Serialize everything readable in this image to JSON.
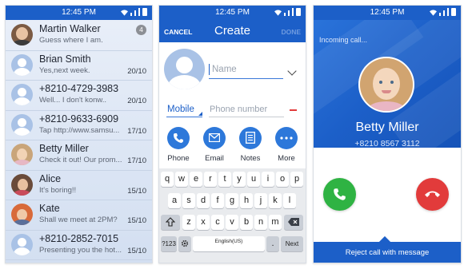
{
  "status_bar": {
    "time": "12:45 PM"
  },
  "messages": [
    {
      "name": "Martin Walker",
      "preview": "Guess where I am.",
      "date": "",
      "badge": "4"
    },
    {
      "name": "Brian Smith",
      "preview": "Yes,next week.",
      "date": "20/10",
      "badge": ""
    },
    {
      "name": "+8210-4729-3983",
      "preview": "Well... I don't konw..",
      "date": "20/10",
      "badge": ""
    },
    {
      "name": "+8210-9633-6909",
      "preview": "Tap http://www.samsu...",
      "date": "17/10",
      "badge": ""
    },
    {
      "name": "Betty Miller",
      "preview": "Check it out! Our prom...",
      "date": "17/10",
      "badge": ""
    },
    {
      "name": "Alice",
      "preview": "It's boring!!",
      "date": "15/10",
      "badge": ""
    },
    {
      "name": "Kate",
      "preview": "Shall we meet at 2PM?",
      "date": "15/10",
      "badge": ""
    },
    {
      "name": "+8210-2852-7015",
      "preview": "Presenting you the hot...",
      "date": "15/10",
      "badge": ""
    }
  ],
  "create": {
    "cancel": "CANCEL",
    "title": "Create",
    "done": "DONE",
    "name_placeholder": "Name",
    "phone_type": "Mobile",
    "phone_placeholder": "Phone number",
    "actions": [
      {
        "label": "Phone",
        "icon": "phone-icon"
      },
      {
        "label": "Email",
        "icon": "email-icon"
      },
      {
        "label": "Notes",
        "icon": "notes-icon"
      },
      {
        "label": "More",
        "icon": "more-icon"
      }
    ]
  },
  "keyboard": {
    "row1": [
      "q",
      "w",
      "e",
      "r",
      "t",
      "y",
      "u",
      "i",
      "o",
      "p"
    ],
    "row2": [
      "a",
      "s",
      "d",
      "f",
      "g",
      "h",
      "j",
      "k",
      "l"
    ],
    "row3": [
      "z",
      "x",
      "c",
      "v",
      "b",
      "n",
      "m"
    ],
    "sym_key": "?123",
    "language_key": "English(US)",
    "period_key": ".",
    "next_key": "Next"
  },
  "call": {
    "label": "Incoming call...",
    "name": "Betty Miller",
    "number": "+8210 8567 3112",
    "reject_message": "Reject call with message"
  },
  "colors": {
    "primary": "#1c5fc8",
    "answer": "#2fb343",
    "decline": "#e23b3b"
  }
}
